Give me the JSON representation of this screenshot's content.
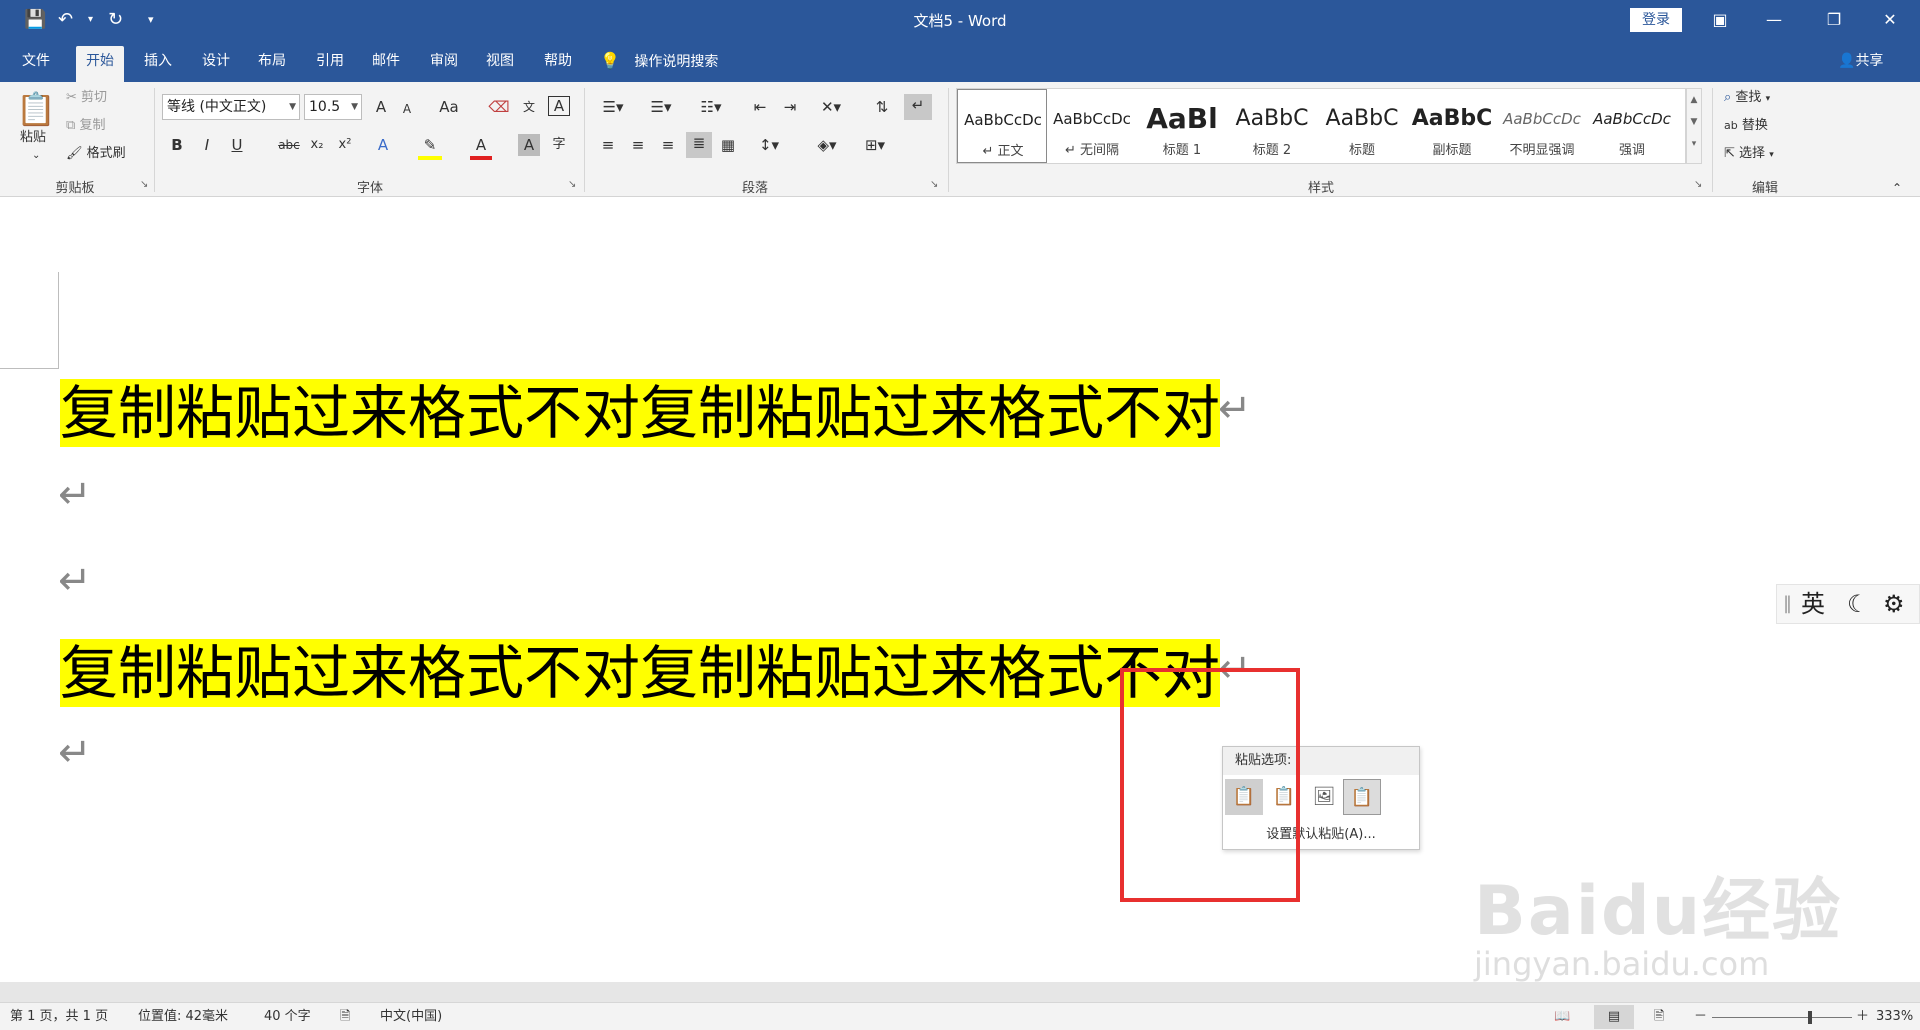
{
  "window": {
    "title": "文档5 - Word",
    "login_label": "登录",
    "window_buttons": [
      "ribbon-display-icon",
      "minimize-icon",
      "restore-icon",
      "close-icon"
    ]
  },
  "quick_access": {
    "save": "save-icon",
    "undo": "undo-icon",
    "redo": "redo-icon",
    "more": "customize-icon"
  },
  "tabs": [
    {
      "label": "文件"
    },
    {
      "label": "开始",
      "active": true
    },
    {
      "label": "插入"
    },
    {
      "label": "设计"
    },
    {
      "label": "布局"
    },
    {
      "label": "引用"
    },
    {
      "label": "邮件"
    },
    {
      "label": "审阅"
    },
    {
      "label": "视图"
    },
    {
      "label": "帮助"
    }
  ],
  "tell_me": "操作说明搜索",
  "share": "共享",
  "ribbon": {
    "clipboard": {
      "label": "剪贴板",
      "paste": "粘贴",
      "cut": "剪切",
      "copy": "复制",
      "format_painter": "格式刷"
    },
    "font": {
      "label": "字体",
      "font_name": "等线 (中文正文)",
      "font_size": "10.5",
      "grow": "A",
      "shrink": "A",
      "change_case": "Aa",
      "bold": "B",
      "italic": "I",
      "underline": "U",
      "strike": "abc",
      "subscript": "x₂",
      "superscript": "x²",
      "text_effect": "A",
      "font_color": "A",
      "char_shading": "A",
      "enclose": "字",
      "border": "A"
    },
    "paragraph": {
      "label": "段落"
    },
    "styles": {
      "label": "样式",
      "items": [
        {
          "preview": "AaBbCcDc",
          "name": "↵ 正文"
        },
        {
          "preview": "AaBbCcDc",
          "name": "↵ 无间隔"
        },
        {
          "preview": "AaBl",
          "name": "标题 1"
        },
        {
          "preview": "AaBbC",
          "name": "标题 2"
        },
        {
          "preview": "AaBbC",
          "name": "标题"
        },
        {
          "preview": "AaBbC",
          "name": "副标题"
        },
        {
          "preview": "AaBbCcDc",
          "name": "不明显强调"
        },
        {
          "preview": "AaBbCcDc",
          "name": "强调"
        }
      ]
    },
    "editing": {
      "label": "编辑",
      "find": "查找",
      "replace": "替换",
      "select": "选择"
    }
  },
  "document": {
    "paragraphs": [
      "复制粘贴过来格式不对复制粘贴过来格式不对",
      "复制粘贴过来格式不对复制粘贴过来格式不对"
    ],
    "highlight_color": "#ffff00",
    "paragraph_mark": "↵"
  },
  "ime": {
    "mode": "英",
    "separator": "‖"
  },
  "paste_popup": {
    "title": "粘贴选项:",
    "options": [
      "keep-source-formatting-icon",
      "merge-formatting-icon",
      "picture-icon",
      "keep-text-only-icon"
    ],
    "set_default": "设置默认粘贴(A)..."
  },
  "annotation_color": "#e8302f",
  "watermark": {
    "logo": "Baidu经验",
    "url": "jingyan.baidu.com"
  },
  "statusbar": {
    "page": "第 1 页，共 1 页",
    "position": "位置值: 42毫米",
    "words": "40 个字",
    "language": "中文(中国)",
    "zoom": "333%",
    "zoom_minus": "－",
    "zoom_plus": "＋",
    "zoom_fraction": 0.7
  },
  "colors": {
    "brand": "#2b579a",
    "ribbon_bg": "#f3f3f3"
  }
}
